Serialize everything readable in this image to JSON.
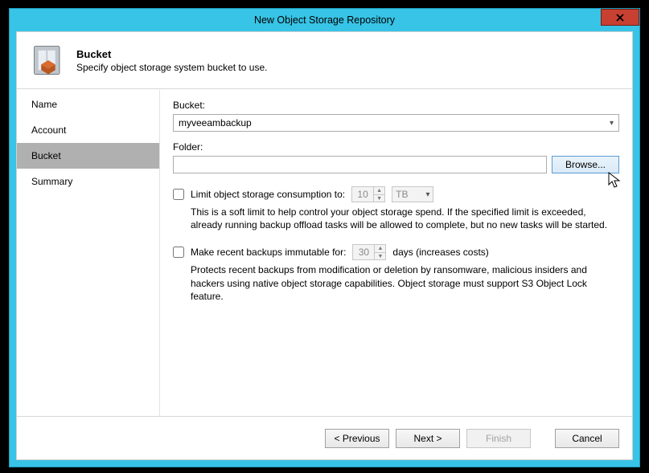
{
  "window": {
    "title": "New Object Storage Repository"
  },
  "header": {
    "title": "Bucket",
    "subtitle": "Specify object storage system bucket to use."
  },
  "nav": [
    {
      "label": "Name"
    },
    {
      "label": "Account"
    },
    {
      "label": "Bucket",
      "active": true
    },
    {
      "label": "Summary"
    }
  ],
  "content": {
    "bucket_label": "Bucket:",
    "bucket_value": "myveeambackup",
    "folder_label": "Folder:",
    "folder_value": "",
    "browse_label": "Browse...",
    "limit": {
      "label_prefix": "Limit object storage consumption to:",
      "value": "10",
      "unit": "TB",
      "help": "This is a soft limit to help control your object storage spend. If the specified limit is exceeded, already running backup offload tasks will be allowed to complete, but no new tasks will be started."
    },
    "immutable": {
      "label_prefix": "Make recent backups immutable for:",
      "value": "30",
      "label_suffix": "days (increases costs)",
      "help": "Protects recent backups from modification or deletion by ransomware, malicious insiders and hackers using native object storage capabilities. Object storage must support S3 Object Lock feature."
    }
  },
  "footer": {
    "previous": "< Previous",
    "next": "Next >",
    "finish": "Finish",
    "cancel": "Cancel"
  }
}
